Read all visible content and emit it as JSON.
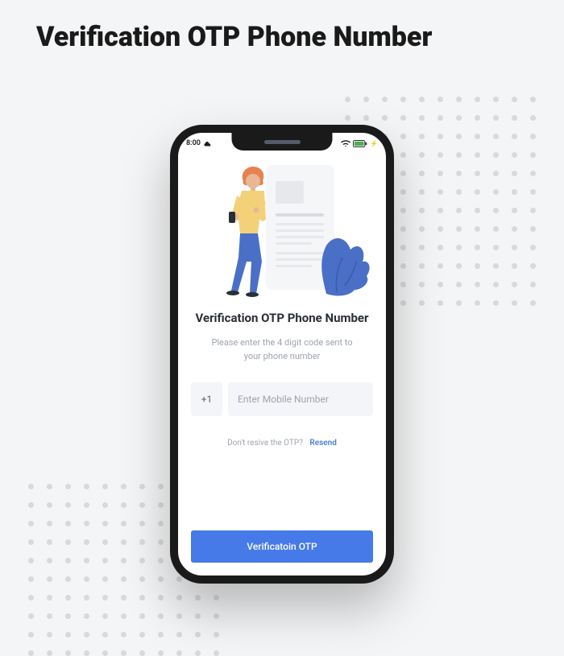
{
  "page": {
    "title": "Verification OTP Phone Number"
  },
  "statusBar": {
    "time": "8:00"
  },
  "screen": {
    "title": "Verification OTP Phone Number",
    "subtitle": "Please enter the 4 digit code sent to your phone number",
    "countryCode": "+1",
    "mobilePlaceholder": "Enter Mobile Number",
    "resendText": "Don't resive the OTP?",
    "resendLink": "Resend",
    "verifyButtonLabel": "Verificatoin OTP"
  },
  "colors": {
    "primary": "#467ae9",
    "textDark": "#2a2e35",
    "textMuted": "#9da3ae",
    "inputBg": "#f4f5f8"
  }
}
